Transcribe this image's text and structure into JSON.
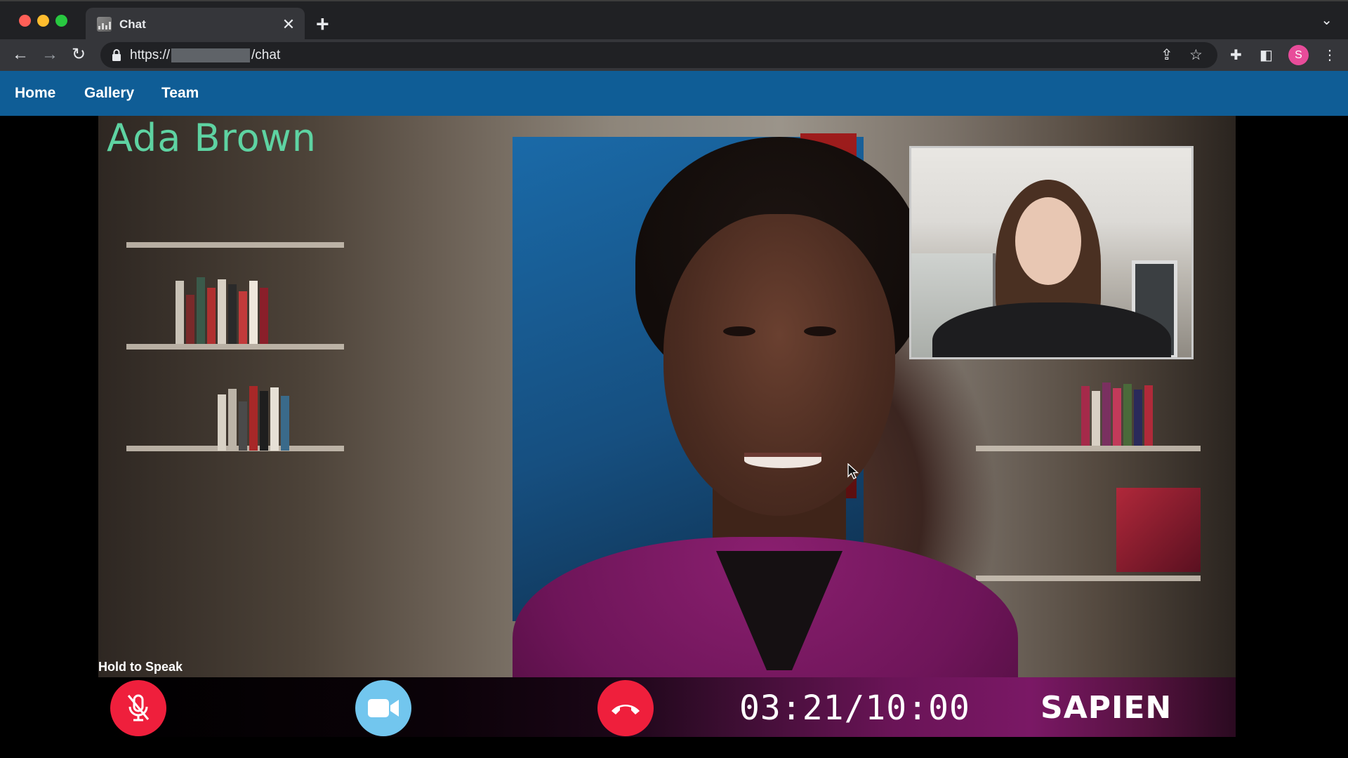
{
  "browser": {
    "tab_title": "Chat",
    "new_tab_symbol": "+",
    "tab_close_symbol": "✕",
    "url_prefix": "https://",
    "url_suffix": "/chat",
    "profile_initial": "S"
  },
  "site_nav": {
    "items": [
      {
        "label": "Home"
      },
      {
        "label": "Gallery"
      },
      {
        "label": "Team"
      }
    ]
  },
  "call": {
    "caller_name": "Ada Brown",
    "hold_to_speak_label": "Hold to Speak",
    "timer_text": "03:21/10:00",
    "brand_text": "SAPIEN",
    "elapsed": "03:21",
    "limit": "10:00"
  },
  "colors": {
    "nav_bg": "#0f5d96",
    "caller_name": "#5ed3a2",
    "mic_button": "#ef1f3c",
    "camera_button": "#72c6ee",
    "hangup_button": "#ef1f3c",
    "control_bar_accent": "#7a1865"
  },
  "icons": {
    "mic": "mic-muted-icon",
    "camera": "video-camera-icon",
    "hangup": "phone-hangup-icon"
  }
}
